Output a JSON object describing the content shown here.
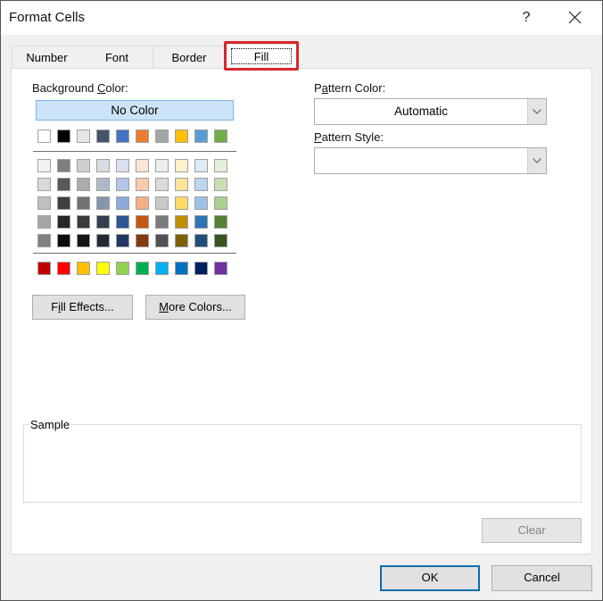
{
  "window": {
    "title": "Format Cells",
    "help_label": "?",
    "close_icon": "close-icon"
  },
  "tabs": [
    {
      "label": "Number",
      "active": false
    },
    {
      "label": "Font",
      "active": false
    },
    {
      "label": "Border",
      "active": false
    },
    {
      "label": "Fill",
      "active": true
    }
  ],
  "highlight_color": "#d9262b",
  "background_color": {
    "label_before": "Background ",
    "label_accel": "C",
    "label_after": "olor:",
    "no_color_label": "No Color",
    "no_color_selected": true,
    "standard_row": [
      "#ffffff",
      "#000000",
      "#e7e6e6",
      "#44546a",
      "#4472c4",
      "#ed7d31",
      "#a5a5a5",
      "#ffc000",
      "#5b9bd5",
      "#70ad47"
    ],
    "theme_rows": [
      [
        "#f2f2f2",
        "#7f7f7f",
        "#d0cece",
        "#d6dce4",
        "#d9e1f2",
        "#fce4d6",
        "#ededed",
        "#fff2cc",
        "#ddebf7",
        "#e2efda"
      ],
      [
        "#d9d9d9",
        "#595959",
        "#aeaaaa",
        "#adb9ca",
        "#b4c6e7",
        "#f8cbad",
        "#dbdbdb",
        "#ffe699",
        "#bdd7ee",
        "#c6e0b4"
      ],
      [
        "#bfbfbf",
        "#404040",
        "#757171",
        "#8497b0",
        "#8ea9db",
        "#f4b084",
        "#c9c9c9",
        "#ffd966",
        "#9bc2e6",
        "#a9d08e"
      ],
      [
        "#a6a6a6",
        "#262626",
        "#3a3838",
        "#333f4f",
        "#2f5597",
        "#c65911",
        "#7b7b7b",
        "#bf8f00",
        "#2e75b6",
        "#548235"
      ],
      [
        "#808080",
        "#0d0d0d",
        "#161616",
        "#222b35",
        "#203764",
        "#833c0c",
        "#525252",
        "#806000",
        "#1f4e78",
        "#375623"
      ]
    ],
    "bright_row": [
      "#c00000",
      "#ff0000",
      "#ffc000",
      "#ffff00",
      "#92d050",
      "#00b050",
      "#00b0f0",
      "#0070c0",
      "#002060",
      "#7030a0"
    ]
  },
  "buttons": {
    "fill_effects": {
      "before": "F",
      "accel": "i",
      "after": "ll Effects..."
    },
    "more_colors": {
      "before": "",
      "accel": "M",
      "after": "ore Colors..."
    },
    "clear": "Clear",
    "ok": "OK",
    "cancel": "Cancel"
  },
  "pattern_color": {
    "label_before": "P",
    "label_accel": "a",
    "label_after": "ttern Color:",
    "value": "Automatic"
  },
  "pattern_style": {
    "label_before": "",
    "label_accel": "P",
    "label_after": "attern Style:",
    "value": ""
  },
  "sample": {
    "label": "Sample"
  }
}
